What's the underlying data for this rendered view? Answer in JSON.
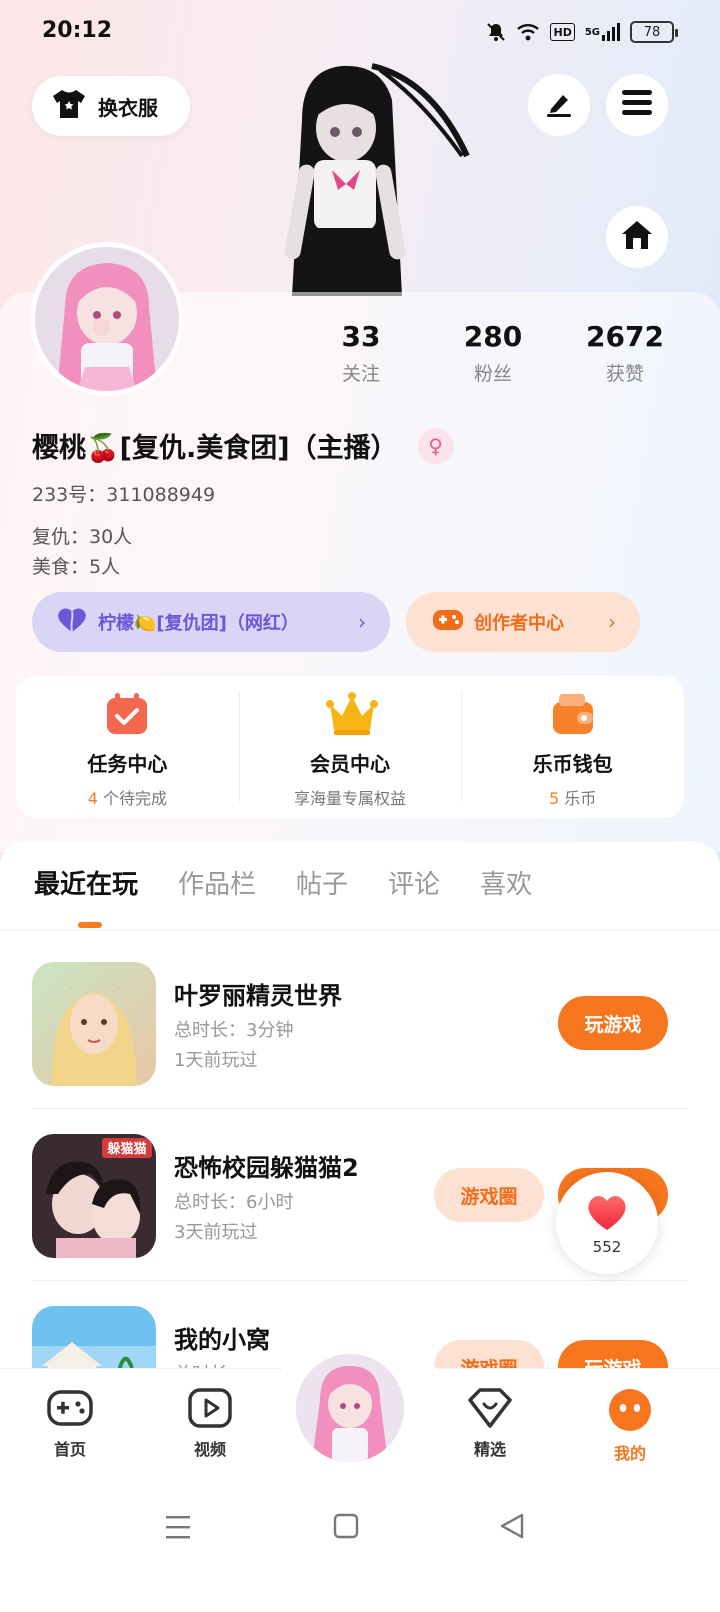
{
  "status_bar": {
    "time": "20:12",
    "network": "5G",
    "hd": "HD",
    "battery": "78"
  },
  "top": {
    "outfit_label": "换衣服",
    "outfit_icon": "tshirt-icon",
    "edit_icon": "pen-icon",
    "menu_icon": "menu-icon",
    "home_icon": "home-icon"
  },
  "stats": [
    {
      "value": "33",
      "label": "关注"
    },
    {
      "value": "280",
      "label": "粉丝"
    },
    {
      "value": "2672",
      "label": "获赞"
    }
  ],
  "profile": {
    "name": "樱桃🍒[复仇.美食团]（主播）",
    "gender": "♀",
    "uid": "233号：311088949",
    "bio_line1": "复仇：30人",
    "bio_line2": "美食：5人"
  },
  "pills": {
    "group_label": "柠檬🍋[复仇团]（网红）",
    "creator_label": "创作者中心",
    "chevron": "›"
  },
  "services": [
    {
      "title": "任务中心",
      "count": "4",
      "sub": "个待完成",
      "icon": "calendar-check-icon"
    },
    {
      "title": "会员中心",
      "count": "",
      "sub": "享海量专属权益",
      "icon": "crown-icon"
    },
    {
      "title": "乐币钱包",
      "count": "5",
      "sub": "乐币",
      "icon": "wallet-icon"
    }
  ],
  "tabs": [
    "最近在玩",
    "作品栏",
    "帖子",
    "评论",
    "喜欢"
  ],
  "games": [
    {
      "name": "叶罗丽精灵世界",
      "duration": "总时长：3分钟",
      "last": "1天前玩过",
      "play": "玩游戏",
      "circle": ""
    },
    {
      "name": "恐怖校园躲猫猫2",
      "duration": "总时长：6小时",
      "last": "3天前玩过",
      "play": "玩游戏",
      "circle": "游戏圈",
      "thumb_text": "躲猫猫"
    },
    {
      "name": "我的小窝",
      "duration": "总时长：",
      "last": "",
      "play": "玩游戏",
      "circle": "游戏圈"
    }
  ],
  "heart": {
    "count": "552"
  },
  "nav": [
    {
      "label": "首页",
      "icon": "gamepad-icon"
    },
    {
      "label": "视频",
      "icon": "play-icon"
    },
    {
      "label": "精选",
      "icon": "heart-diamond-icon"
    },
    {
      "label": "我的",
      "icon": "smile-icon"
    }
  ],
  "colors": {
    "accent": "#f5761e",
    "purple": "#6b57d8"
  }
}
